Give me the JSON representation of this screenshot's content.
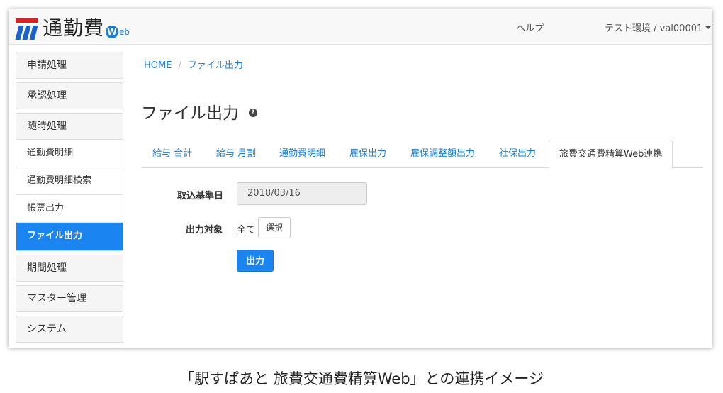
{
  "navbar": {
    "brand_title": "通勤費",
    "brand_web_letter": "W",
    "brand_web_rest": "eb",
    "help": "ヘルプ",
    "user": "テスト環境 / val00001"
  },
  "sidebar": {
    "item_apply": "申請処理",
    "item_approve": "承認処理",
    "group_adhoc": {
      "label": "随時処理",
      "subs": [
        "通勤費明細",
        "通勤費明細検索",
        "帳票出力",
        "ファイル出力"
      ]
    },
    "item_period": "期間処理",
    "item_master": "マスター管理",
    "item_system": "システム"
  },
  "breadcrumb": {
    "home": "HOME",
    "sep": "/",
    "current": "ファイル出力"
  },
  "page": {
    "title": "ファイル出力",
    "help_icon": "?"
  },
  "tabs": [
    "給与 合計",
    "給与 月割",
    "通勤費明細",
    "雇保出力",
    "雇保調整額出力",
    "社保出力",
    "旅費交通費精算Web連携"
  ],
  "form": {
    "base_date_label": "取込基準日",
    "base_date_value": "2018/03/16",
    "target_label": "出力対象",
    "target_value": "全て",
    "select_button": "選択",
    "output_button": "出力"
  },
  "caption": "「駅すぱあと 旅費交通費精算Web」との連携イメージ",
  "colors": {
    "accent": "#1a84f0",
    "link": "#1a7fd6",
    "brand_tag": "#e02020"
  }
}
